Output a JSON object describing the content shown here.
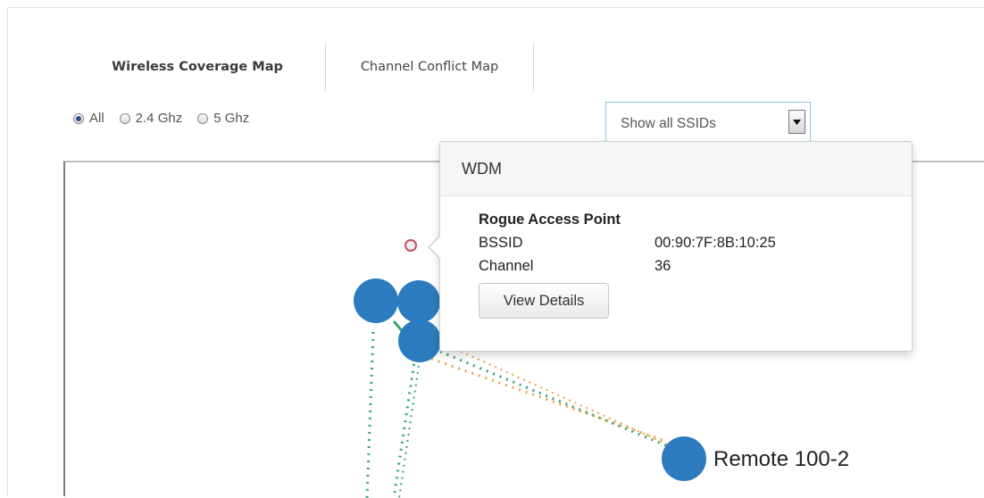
{
  "tabs": [
    {
      "label": "Wireless Coverage Map",
      "active": true
    },
    {
      "label": "Channel Conflict Map",
      "active": false
    }
  ],
  "band_filter": {
    "options": [
      "All",
      "2.4 Ghz",
      "5 Ghz"
    ],
    "selected": "All"
  },
  "ssid_select": {
    "value": "Show all SSIDs",
    "icon": "chevron-down-icon"
  },
  "map": {
    "node_color": "#2d7bbf",
    "rogue_color": "#c5505f",
    "link_colors": {
      "mesh_green": "#3aa372",
      "interference_orange": "#e8a54a"
    },
    "labels": {
      "remote": "Remote 100-2"
    }
  },
  "popover": {
    "header": "WDM",
    "title": "Rogue Access Point",
    "rows": [
      {
        "key": "BSSID",
        "value": "00:90:7F:8B:10:25"
      },
      {
        "key": "Channel",
        "value": "36"
      }
    ],
    "button_label": "View Details"
  }
}
